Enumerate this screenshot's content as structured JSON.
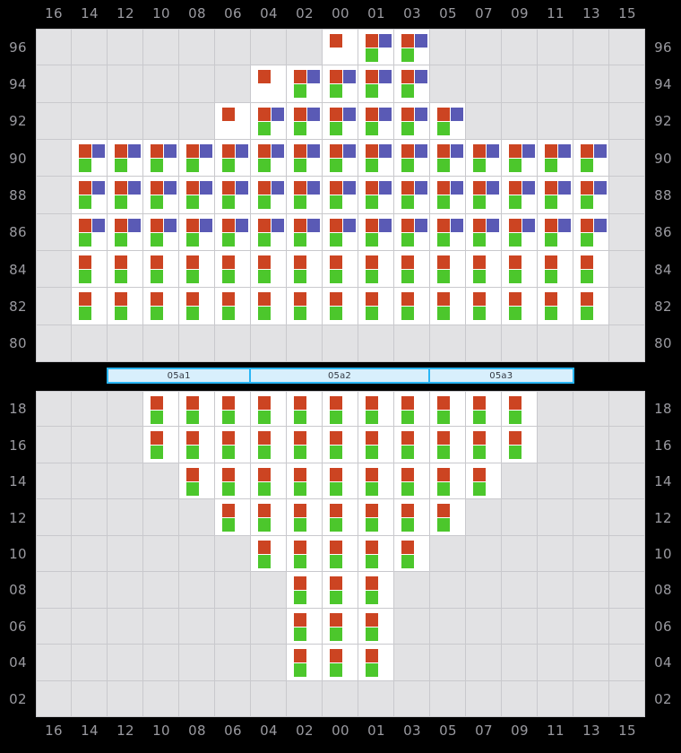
{
  "colors": {
    "page_background": "#000000",
    "cell_empty": "#e2e2e4",
    "cell_filled": "#ffffff",
    "grid_line": "#c9c9cd",
    "axis_label": "#9a9aa0",
    "mark_red": "#cc4422",
    "mark_purple": "#5a5ab5",
    "mark_green": "#4cc72c",
    "segment_border": "#29b6f6",
    "segment_fill": "#d8effc"
  },
  "columns": [
    "16",
    "14",
    "12",
    "10",
    "08",
    "06",
    "04",
    "02",
    "00",
    "01",
    "03",
    "05",
    "07",
    "09",
    "11",
    "13",
    "15"
  ],
  "top_panel": {
    "rows": [
      "96",
      "94",
      "92",
      "90",
      "88",
      "86",
      "84",
      "82",
      "80"
    ],
    "cells": [
      [
        null,
        null,
        null,
        null,
        null,
        null,
        null,
        null,
        {
          "marks": [
            "red"
          ]
        },
        {
          "marks": [
            "red",
            "purple",
            "green"
          ]
        },
        {
          "marks": [
            "red",
            "purple",
            "green"
          ]
        },
        null,
        null,
        null,
        null,
        null,
        null
      ],
      [
        null,
        null,
        null,
        null,
        null,
        null,
        {
          "marks": [
            "red"
          ]
        },
        {
          "marks": [
            "red",
            "purple",
            "green"
          ]
        },
        {
          "marks": [
            "red",
            "purple",
            "green"
          ]
        },
        {
          "marks": [
            "red",
            "purple",
            "green"
          ]
        },
        {
          "marks": [
            "red",
            "purple",
            "green"
          ]
        },
        null,
        null,
        null,
        null,
        null,
        null
      ],
      [
        null,
        null,
        null,
        null,
        null,
        {
          "marks": [
            "red"
          ]
        },
        {
          "marks": [
            "red",
            "purple",
            "green"
          ]
        },
        {
          "marks": [
            "red",
            "purple",
            "green"
          ]
        },
        {
          "marks": [
            "red",
            "purple",
            "green"
          ]
        },
        {
          "marks": [
            "red",
            "purple",
            "green"
          ]
        },
        {
          "marks": [
            "red",
            "purple",
            "green"
          ]
        },
        {
          "marks": [
            "red",
            "purple",
            "green"
          ]
        },
        null,
        null,
        null,
        null,
        null
      ],
      [
        null,
        {
          "marks": [
            "red",
            "purple",
            "green"
          ]
        },
        {
          "marks": [
            "red",
            "purple",
            "green"
          ]
        },
        {
          "marks": [
            "red",
            "purple",
            "green"
          ]
        },
        {
          "marks": [
            "red",
            "purple",
            "green"
          ]
        },
        {
          "marks": [
            "red",
            "purple",
            "green"
          ]
        },
        {
          "marks": [
            "red",
            "purple",
            "green"
          ]
        },
        {
          "marks": [
            "red",
            "purple",
            "green"
          ]
        },
        {
          "marks": [
            "red",
            "purple",
            "green"
          ]
        },
        {
          "marks": [
            "red",
            "purple",
            "green"
          ]
        },
        {
          "marks": [
            "red",
            "purple",
            "green"
          ]
        },
        {
          "marks": [
            "red",
            "purple",
            "green"
          ]
        },
        {
          "marks": [
            "red",
            "purple",
            "green"
          ]
        },
        {
          "marks": [
            "red",
            "purple",
            "green"
          ]
        },
        {
          "marks": [
            "red",
            "purple",
            "green"
          ]
        },
        {
          "marks": [
            "red",
            "purple",
            "green"
          ]
        },
        null
      ],
      [
        null,
        {
          "marks": [
            "red",
            "purple",
            "green"
          ]
        },
        {
          "marks": [
            "red",
            "purple",
            "green"
          ]
        },
        {
          "marks": [
            "red",
            "purple",
            "green"
          ]
        },
        {
          "marks": [
            "red",
            "purple",
            "green"
          ]
        },
        {
          "marks": [
            "red",
            "purple",
            "green"
          ]
        },
        {
          "marks": [
            "red",
            "purple",
            "green"
          ]
        },
        {
          "marks": [
            "red",
            "purple",
            "green"
          ]
        },
        {
          "marks": [
            "red",
            "purple",
            "green"
          ]
        },
        {
          "marks": [
            "red",
            "purple",
            "green"
          ]
        },
        {
          "marks": [
            "red",
            "purple",
            "green"
          ]
        },
        {
          "marks": [
            "red",
            "purple",
            "green"
          ]
        },
        {
          "marks": [
            "red",
            "purple",
            "green"
          ]
        },
        {
          "marks": [
            "red",
            "purple",
            "green"
          ]
        },
        {
          "marks": [
            "red",
            "purple",
            "green"
          ]
        },
        {
          "marks": [
            "red",
            "purple",
            "green"
          ]
        },
        null
      ],
      [
        null,
        {
          "marks": [
            "red",
            "purple",
            "green"
          ]
        },
        {
          "marks": [
            "red",
            "purple",
            "green"
          ]
        },
        {
          "marks": [
            "red",
            "purple",
            "green"
          ]
        },
        {
          "marks": [
            "red",
            "purple",
            "green"
          ]
        },
        {
          "marks": [
            "red",
            "purple",
            "green"
          ]
        },
        {
          "marks": [
            "red",
            "purple",
            "green"
          ]
        },
        {
          "marks": [
            "red",
            "purple",
            "green"
          ]
        },
        {
          "marks": [
            "red",
            "purple",
            "green"
          ]
        },
        {
          "marks": [
            "red",
            "purple",
            "green"
          ]
        },
        {
          "marks": [
            "red",
            "purple",
            "green"
          ]
        },
        {
          "marks": [
            "red",
            "purple",
            "green"
          ]
        },
        {
          "marks": [
            "red",
            "purple",
            "green"
          ]
        },
        {
          "marks": [
            "red",
            "purple",
            "green"
          ]
        },
        {
          "marks": [
            "red",
            "purple",
            "green"
          ]
        },
        {
          "marks": [
            "red",
            "purple",
            "green"
          ]
        },
        null
      ],
      [
        null,
        {
          "marks": [
            "red",
            "green"
          ]
        },
        {
          "marks": [
            "red",
            "green"
          ]
        },
        {
          "marks": [
            "red",
            "green"
          ]
        },
        {
          "marks": [
            "red",
            "green"
          ]
        },
        {
          "marks": [
            "red",
            "green"
          ]
        },
        {
          "marks": [
            "red",
            "green"
          ]
        },
        {
          "marks": [
            "red",
            "green"
          ]
        },
        {
          "marks": [
            "red",
            "green"
          ]
        },
        {
          "marks": [
            "red",
            "green"
          ]
        },
        {
          "marks": [
            "red",
            "green"
          ]
        },
        {
          "marks": [
            "red",
            "green"
          ]
        },
        {
          "marks": [
            "red",
            "green"
          ]
        },
        {
          "marks": [
            "red",
            "green"
          ]
        },
        {
          "marks": [
            "red",
            "green"
          ]
        },
        {
          "marks": [
            "red",
            "green"
          ]
        },
        null
      ],
      [
        null,
        {
          "marks": [
            "red",
            "green"
          ]
        },
        {
          "marks": [
            "red",
            "green"
          ]
        },
        {
          "marks": [
            "red",
            "green"
          ]
        },
        {
          "marks": [
            "red",
            "green"
          ]
        },
        {
          "marks": [
            "red",
            "green"
          ]
        },
        {
          "marks": [
            "red",
            "green"
          ]
        },
        {
          "marks": [
            "red",
            "green"
          ]
        },
        {
          "marks": [
            "red",
            "green"
          ]
        },
        {
          "marks": [
            "red",
            "green"
          ]
        },
        {
          "marks": [
            "red",
            "green"
          ]
        },
        {
          "marks": [
            "red",
            "green"
          ]
        },
        {
          "marks": [
            "red",
            "green"
          ]
        },
        {
          "marks": [
            "red",
            "green"
          ]
        },
        {
          "marks": [
            "red",
            "green"
          ]
        },
        {
          "marks": [
            "red",
            "green"
          ]
        },
        null
      ],
      [
        null,
        null,
        null,
        null,
        null,
        null,
        null,
        null,
        null,
        null,
        null,
        null,
        null,
        null,
        null,
        null,
        null
      ]
    ]
  },
  "segment_bar": {
    "segments": [
      {
        "label": "05a1",
        "span": 4
      },
      {
        "label": "05a2",
        "span": 5
      },
      {
        "label": "05a3",
        "span": 4
      }
    ]
  },
  "bottom_panel": {
    "rows": [
      "18",
      "16",
      "14",
      "12",
      "10",
      "08",
      "06",
      "04",
      "02"
    ],
    "cells": [
      [
        null,
        null,
        null,
        {
          "marks": [
            "red",
            "green"
          ]
        },
        {
          "marks": [
            "red",
            "green"
          ]
        },
        {
          "marks": [
            "red",
            "green"
          ]
        },
        {
          "marks": [
            "red",
            "green"
          ]
        },
        {
          "marks": [
            "red",
            "green"
          ]
        },
        {
          "marks": [
            "red",
            "green"
          ]
        },
        {
          "marks": [
            "red",
            "green"
          ]
        },
        {
          "marks": [
            "red",
            "green"
          ]
        },
        {
          "marks": [
            "red",
            "green"
          ]
        },
        {
          "marks": [
            "red",
            "green"
          ]
        },
        {
          "marks": [
            "red",
            "green"
          ]
        },
        null,
        null,
        null
      ],
      [
        null,
        null,
        null,
        {
          "marks": [
            "red",
            "green"
          ]
        },
        {
          "marks": [
            "red",
            "green"
          ]
        },
        {
          "marks": [
            "red",
            "green"
          ]
        },
        {
          "marks": [
            "red",
            "green"
          ]
        },
        {
          "marks": [
            "red",
            "green"
          ]
        },
        {
          "marks": [
            "red",
            "green"
          ]
        },
        {
          "marks": [
            "red",
            "green"
          ]
        },
        {
          "marks": [
            "red",
            "green"
          ]
        },
        {
          "marks": [
            "red",
            "green"
          ]
        },
        {
          "marks": [
            "red",
            "green"
          ]
        },
        {
          "marks": [
            "red",
            "green"
          ]
        },
        null,
        null,
        null
      ],
      [
        null,
        null,
        null,
        null,
        {
          "marks": [
            "red",
            "green"
          ]
        },
        {
          "marks": [
            "red",
            "green"
          ]
        },
        {
          "marks": [
            "red",
            "green"
          ]
        },
        {
          "marks": [
            "red",
            "green"
          ]
        },
        {
          "marks": [
            "red",
            "green"
          ]
        },
        {
          "marks": [
            "red",
            "green"
          ]
        },
        {
          "marks": [
            "red",
            "green"
          ]
        },
        {
          "marks": [
            "red",
            "green"
          ]
        },
        {
          "marks": [
            "red",
            "green"
          ]
        },
        null,
        null,
        null,
        null
      ],
      [
        null,
        null,
        null,
        null,
        null,
        {
          "marks": [
            "red",
            "green"
          ]
        },
        {
          "marks": [
            "red",
            "green"
          ]
        },
        {
          "marks": [
            "red",
            "green"
          ]
        },
        {
          "marks": [
            "red",
            "green"
          ]
        },
        {
          "marks": [
            "red",
            "green"
          ]
        },
        {
          "marks": [
            "red",
            "green"
          ]
        },
        {
          "marks": [
            "red",
            "green"
          ]
        },
        null,
        null,
        null,
        null,
        null
      ],
      [
        null,
        null,
        null,
        null,
        null,
        null,
        {
          "marks": [
            "red",
            "green"
          ]
        },
        {
          "marks": [
            "red",
            "green"
          ]
        },
        {
          "marks": [
            "red",
            "green"
          ]
        },
        {
          "marks": [
            "red",
            "green"
          ]
        },
        {
          "marks": [
            "red",
            "green"
          ]
        },
        null,
        null,
        null,
        null,
        null,
        null
      ],
      [
        null,
        null,
        null,
        null,
        null,
        null,
        null,
        {
          "marks": [
            "red",
            "green"
          ]
        },
        {
          "marks": [
            "red",
            "green"
          ]
        },
        {
          "marks": [
            "red",
            "green"
          ]
        },
        null,
        null,
        null,
        null,
        null,
        null,
        null
      ],
      [
        null,
        null,
        null,
        null,
        null,
        null,
        null,
        {
          "marks": [
            "red",
            "green"
          ]
        },
        {
          "marks": [
            "red",
            "green"
          ]
        },
        {
          "marks": [
            "red",
            "green"
          ]
        },
        null,
        null,
        null,
        null,
        null,
        null,
        null
      ],
      [
        null,
        null,
        null,
        null,
        null,
        null,
        null,
        {
          "marks": [
            "red",
            "green"
          ]
        },
        {
          "marks": [
            "red",
            "green"
          ]
        },
        {
          "marks": [
            "red",
            "green"
          ]
        },
        null,
        null,
        null,
        null,
        null,
        null,
        null
      ],
      [
        null,
        null,
        null,
        null,
        null,
        null,
        null,
        null,
        null,
        null,
        null,
        null,
        null,
        null,
        null,
        null,
        null
      ]
    ]
  }
}
